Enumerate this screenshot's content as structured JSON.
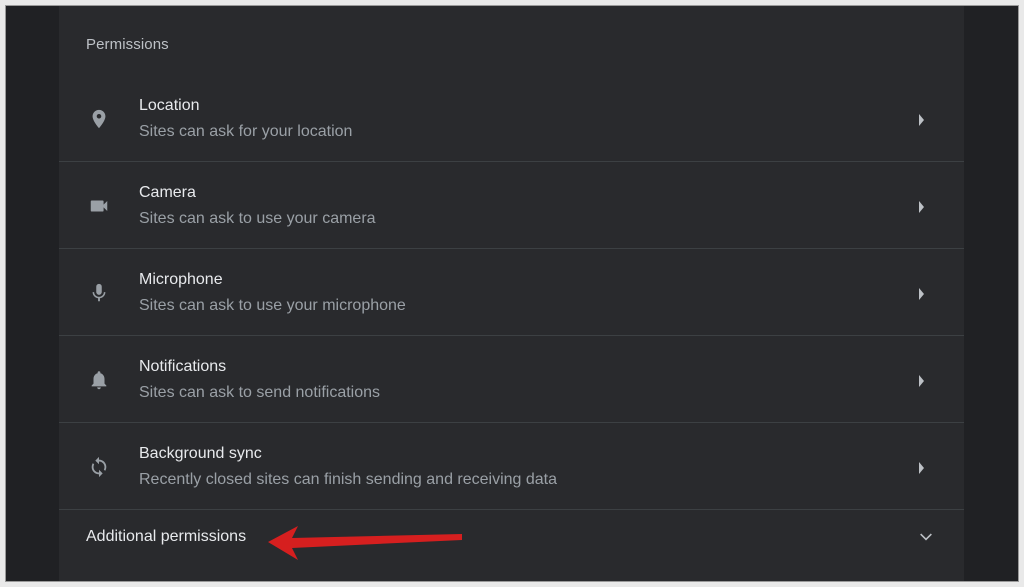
{
  "section": {
    "title": "Permissions"
  },
  "permissions": [
    {
      "title": "Location",
      "subtitle": "Sites can ask for your location",
      "icon": "location-pin-icon"
    },
    {
      "title": "Camera",
      "subtitle": "Sites can ask to use your camera",
      "icon": "videocam-icon"
    },
    {
      "title": "Microphone",
      "subtitle": "Sites can ask to use your microphone",
      "icon": "mic-icon"
    },
    {
      "title": "Notifications",
      "subtitle": "Sites can ask to send notifications",
      "icon": "bell-icon"
    },
    {
      "title": "Background sync",
      "subtitle": "Recently closed sites can finish sending and receiving data",
      "icon": "sync-icon"
    }
  ],
  "additional": {
    "label": "Additional permissions",
    "expanded": false
  },
  "colors": {
    "page_background": "#202124",
    "panel_background": "#292a2d",
    "primary_text": "#e8eaed",
    "secondary_text": "#9aa0a6",
    "divider": "#3c4043",
    "annotation_arrow": "#d61f1f"
  }
}
